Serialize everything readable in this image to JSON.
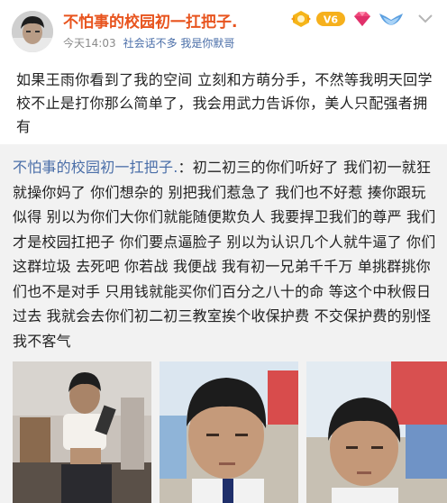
{
  "post": {
    "username": "不怕事的校园初一扛把子.",
    "time": "今天14:03",
    "source": "社会话不多 我是你默哥",
    "text": "如果王雨你看到了我的空间 立刻和方萌分手，不然等我明天回学校不止是打你那么简单了，我会用武力告诉你，美人只配强者拥有",
    "badges": [
      "vip-badge-icon",
      "v-level-badge-icon",
      "diamond-icon",
      "wings-icon"
    ],
    "colors": {
      "username": "#e8541e",
      "link": "#4a6ea8",
      "meta": "#8a8a8a",
      "repost_bg": "#f2f2f2"
    }
  },
  "repost": {
    "username": "不怕事的校园初一扛把子.",
    "separator": "：",
    "text": "初二初三的你们听好了 我们初一就狂就操你妈了 你们想杂的 别把我们惹急了 我们也不好惹 揍你跟玩似得 别以为你们大你们就能随便欺负人 我要捍卫我们的尊严 我们才是校园扛把子 你们要点逼脸子 别以为认识几个人就牛逼了 你们这群垃圾 去死吧 你若战 我便战 我有初一兄弟千千万 单挑群挑你们也不是对手 只用钱就能买你们百分之八十的命 等这个中秋假日过去 我就会去你们初二初三教室挨个收保护费 不交保护费的别怪我不客气"
  }
}
